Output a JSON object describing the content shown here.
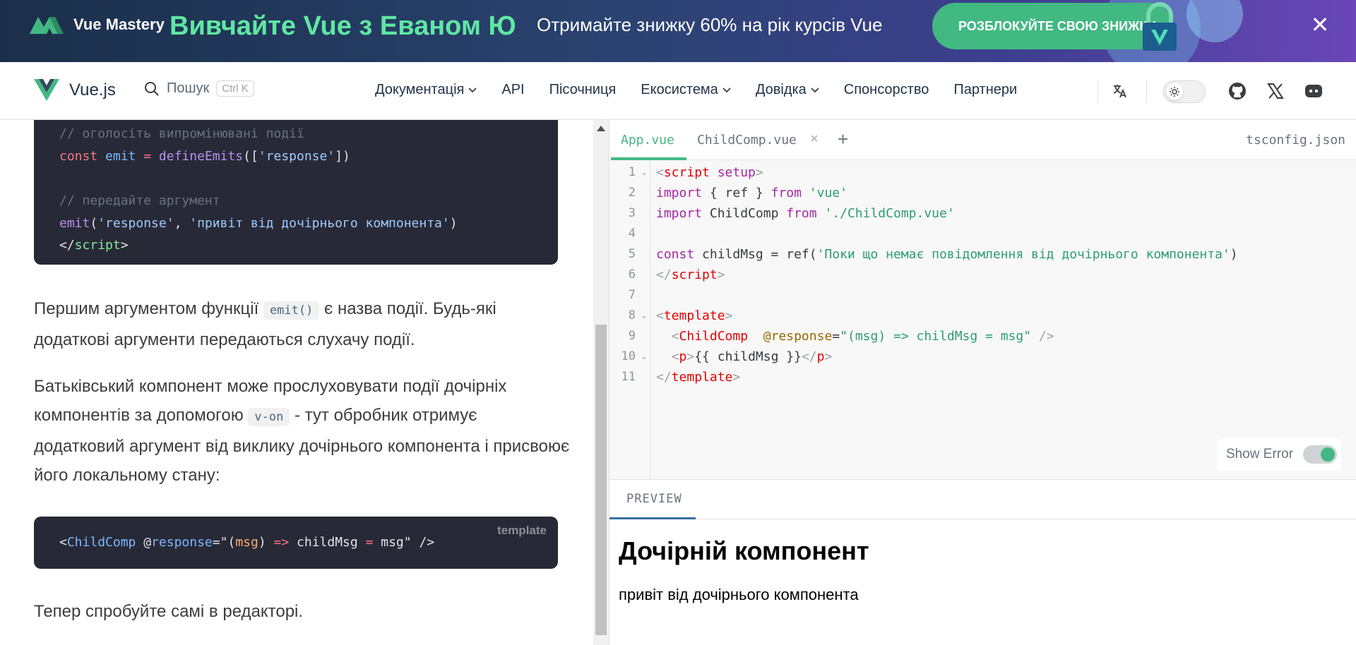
{
  "banner": {
    "logo_text": "Vue Mastery",
    "headline": "Вивчайте Vue з Еваном Ю",
    "offer": "Отримайте знижку 60% на рік курсів Vue",
    "cta_label": "РОЗБЛОКУЙТЕ СВОЮ ЗНИЖКУ",
    "close_label": "✕",
    "colors": {
      "accent": "#5fe7a3",
      "cta": "#42b883"
    }
  },
  "nav": {
    "brand": "Vue.js",
    "search_label": "Пошук",
    "search_shortcut": "Ctrl K",
    "menu": [
      {
        "label": "Документація",
        "has_dropdown": true
      },
      {
        "label": "API",
        "has_dropdown": false
      },
      {
        "label": "Пісочниця",
        "has_dropdown": false
      },
      {
        "label": "Екосистема",
        "has_dropdown": true
      },
      {
        "label": "Довідка",
        "has_dropdown": true
      },
      {
        "label": "Спонсорство",
        "has_dropdown": false
      },
      {
        "label": "Партнери",
        "has_dropdown": false
      }
    ],
    "icons": [
      "translate-icon",
      "sun-icon",
      "github-icon",
      "x-icon",
      "discord-icon"
    ]
  },
  "content": {
    "code1": {
      "line1": "// оголосіть випромінювані події",
      "line2_kw": "const",
      "line2_var": "emit",
      "line2_op": "=",
      "line2_fn": "defineEmits",
      "line2_open": "([",
      "line2_str": "'response'",
      "line2_close": "])",
      "line4": "// передайте аргумент",
      "line5_fn": "emit",
      "line5_open": "(",
      "line5_str1": "'response'",
      "line5_comma": ", ",
      "line5_str2": "'привіт від дочірнього компонента'",
      "line5_close": ")",
      "line6_open": "</",
      "line6_tag": "script",
      "line6_close": ">"
    },
    "para1_a": "Першим аргументом функції ",
    "para1_code": "emit()",
    "para1_b": " є назва події. Будь-які додаткові аргументи передаються слухачу події.",
    "para2_a": "Батьківський компонент може прослуховувати події дочірніх компонентів за допомогою ",
    "para2_code": "v-on",
    "para2_b": " - тут обробник отримує додатковий аргумент від виклику дочірнього компонента і присвоює його локальному стану:",
    "code2": {
      "lang": "template",
      "open": "<",
      "tag": "ChildComp",
      "space": " ",
      "at": "@",
      "attr": "response",
      "eq": "=",
      "q1": "\"(",
      "param": "msg",
      "paren": ")",
      "arrow": " => ",
      "body": "childMsg ",
      "eq2": "=",
      "body2": " msg",
      "q2": "\"",
      "end": " />"
    },
    "para3": "Тепер спробуйте самі в редакторі."
  },
  "editor": {
    "tabs": {
      "active": "App.vue",
      "second": "ChildComp.vue",
      "close": "×",
      "add": "+",
      "config": "tsconfig.json"
    },
    "line_numbers": [
      "1",
      "2",
      "3",
      "4",
      "5",
      "6",
      "7",
      "8",
      "9",
      "10",
      "11"
    ],
    "fold_marker": "⌄",
    "code": {
      "l1_lt": "<",
      "l1_tag": "script",
      "l1_attr": " setup",
      "l1_gt": ">",
      "l2_kw": "import",
      "l2_mid": " { ref } ",
      "l2_from": "from",
      "l2_str": " 'vue'",
      "l3_kw": "import",
      "l3_mid": " ChildComp ",
      "l3_from": "from",
      "l3_str": " './ChildComp.vue'",
      "l5_kw": "const",
      "l5_mid": " childMsg = ref(",
      "l5_str": "'Поки що немає повідомлення від дочірнього компонента'",
      "l5_end": ")",
      "l6_lt": "</",
      "l6_tag": "script",
      "l6_gt": ">",
      "l8_lt": "<",
      "l8_tag": "template",
      "l8_gt": ">",
      "l9_indent": "  ",
      "l9_lt": "<",
      "l9_tag": "ChildComp",
      "l9_attr": "  @response",
      "l9_eq": "=",
      "l9_str": "\"(msg) => childMsg = msg\"",
      "l9_end": " />",
      "l10_indent": "  ",
      "l10_lt": "<",
      "l10_tag": "p",
      "l10_gt": ">",
      "l10_text": "{{ childMsg }}",
      "l10_clt": "</",
      "l10_ctag": "p",
      "l10_cgt": ">",
      "l11_lt": "</",
      "l11_tag": "template",
      "l11_gt": ">"
    },
    "show_error_label": "Show Error",
    "preview_tab": "PREVIEW",
    "preview_heading": "Дочірній компонент",
    "preview_text": "привіт від дочірнього компонента"
  }
}
